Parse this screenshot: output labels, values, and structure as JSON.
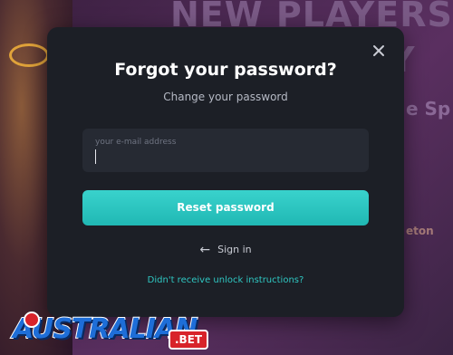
{
  "background": {
    "headline_line1": "NEW PLAYERS",
    "headline_line2": "Y",
    "headline_line3": "e Sp",
    "headline_line4": "eton"
  },
  "modal": {
    "close_icon": "close-icon",
    "title": "Forgot your password?",
    "subtitle": "Change your password",
    "email": {
      "placeholder": "your e-mail address",
      "value": ""
    },
    "reset_button": "Reset password",
    "signin_arrow": "←",
    "signin_link": "Sign in",
    "unlock_link": "Didn't receive unlock instructions?"
  },
  "logo": {
    "main": "AUSTRALIAN",
    "suffix": ".BET"
  },
  "colors": {
    "accent": "#2fc7c2",
    "modal_bg": "#1c1f26",
    "field_bg": "#262a33"
  }
}
